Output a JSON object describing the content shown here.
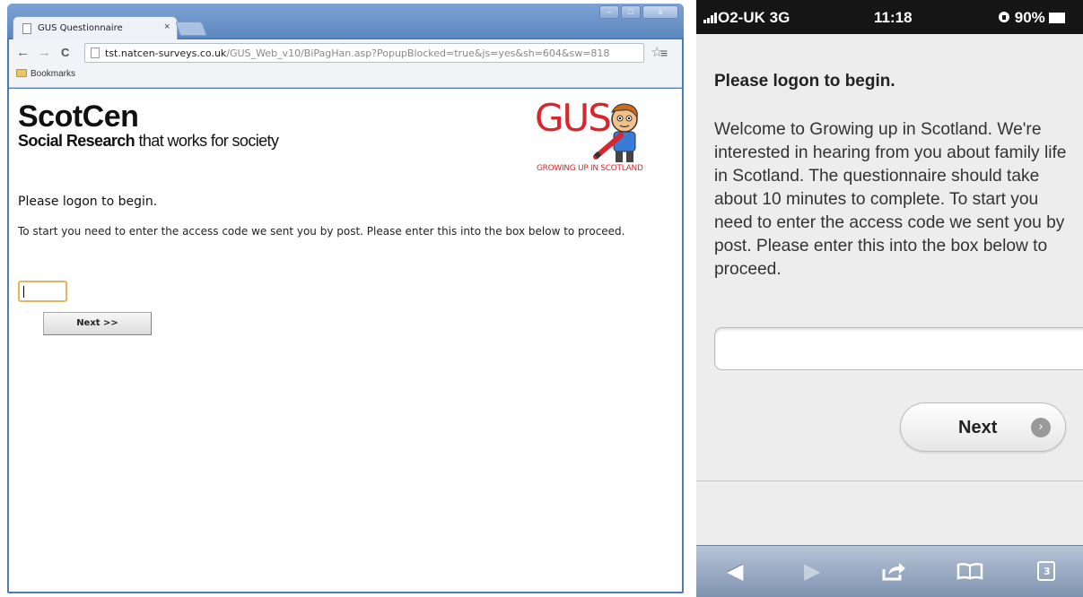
{
  "desktop": {
    "tab_title": "GUS Questionnaire",
    "tab_close": "×",
    "window_buttons": {
      "minimize": "–",
      "maximize": "□",
      "close": "x"
    },
    "nav": {
      "back": "←",
      "forward": "→",
      "reload": "C"
    },
    "url_host": "tst.natcen-surveys.co.uk",
    "url_path": "/GUS_Web_v10/BiPagHan.asp?PopupBlocked=true&js=yes&sh=604&sw=818",
    "star_icon": "☆",
    "menu_icon": "≡",
    "bookmarks_label": "Bookmarks",
    "brand": {
      "name": "ScotCen",
      "tagline_bold": "Social Research",
      "tagline_rest": " that works for society"
    },
    "gus_logo": {
      "text": "GUS",
      "subtitle": "GROWING UP IN SCOTLAND"
    },
    "heading": "Please logon to begin.",
    "intro": "To start you need to enter the access code we sent you by post. Please enter this into the box below to proceed.",
    "next_label": "Next >>"
  },
  "mobile": {
    "carrier": "O2-UK  3G",
    "time": "11:18",
    "battery": "90%",
    "heading": "Please logon to begin.",
    "body": "Welcome to Growing up in Scotland. We're interested in hearing from you about family life in Scotland. The questionnaire should take about 10 minutes to complete. To start you need to enter the access code we sent you by post. Please enter this into the box below to proceed.",
    "next_label": "Next",
    "next_arrow": "›",
    "toolbar": {
      "back": "◀",
      "forward": "▶",
      "share": "⇪",
      "bookmarks": "📖",
      "tabs_count": "3"
    }
  },
  "colors": {
    "gus_red": "#d8262f",
    "chrome_frame": "#5d87c0",
    "ios_toolbar": "#8fa2bd"
  }
}
